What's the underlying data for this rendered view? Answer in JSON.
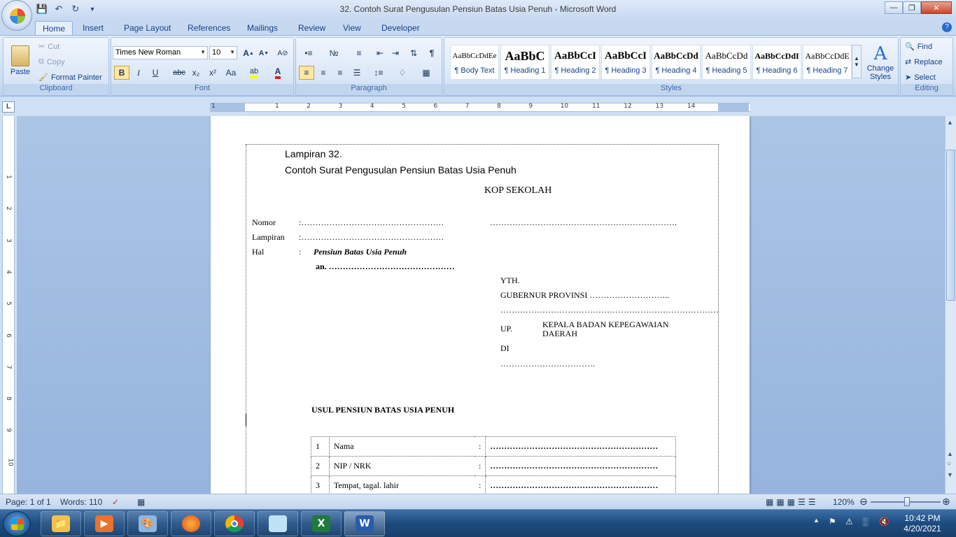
{
  "window": {
    "title": "32. Contoh Surat Pengusulan Pensiun Batas Usia Penuh - Microsoft Word"
  },
  "qat": [
    "save-icon",
    "undo-icon",
    "redo-icon",
    "customize-icon"
  ],
  "tabs": [
    "Home",
    "Insert",
    "Page Layout",
    "References",
    "Mailings",
    "Review",
    "View",
    "Developer"
  ],
  "ribbon": {
    "clipboard": {
      "paste": "Paste",
      "cut": "Cut",
      "copy": "Copy",
      "format_painter": "Format Painter",
      "label": "Clipboard"
    },
    "font": {
      "family": "Times New Roman",
      "size": "10",
      "bold": "B",
      "italic": "I",
      "underline": "U",
      "strike": "abc",
      "subscript": "x₂",
      "superscript": "x²",
      "change_case": "Aa",
      "label": "Font"
    },
    "paragraph": {
      "label": "Paragraph"
    },
    "styles": {
      "cards": [
        {
          "sample": "AaBbCcDdEe",
          "name": "¶ Body Text"
        },
        {
          "sample": "AaBbC",
          "name": "¶ Heading 1"
        },
        {
          "sample": "AaBbCcI",
          "name": "¶ Heading 2"
        },
        {
          "sample": "AaBbCcI",
          "name": "¶ Heading 3"
        },
        {
          "sample": "AaBbCcDd",
          "name": "¶ Heading 4"
        },
        {
          "sample": "AaBbCcDd",
          "name": "¶ Heading 5"
        },
        {
          "sample": "AaBbCcDdI",
          "name": "¶ Heading 6"
        },
        {
          "sample": "AaBbCcDdE",
          "name": "¶ Heading 7"
        }
      ],
      "change_styles": "Change Styles",
      "label": "Styles"
    },
    "editing": {
      "find": "Find",
      "replace": "Replace",
      "select": "Select",
      "label": "Editing"
    }
  },
  "ruler": {
    "corner": "L",
    "marks": [
      "1",
      "1",
      "2",
      "3",
      "4",
      "5",
      "6",
      "7",
      "8",
      "9",
      "10",
      "11",
      "12",
      "13",
      "14"
    ],
    "vmarks": [
      "1",
      "2",
      "3",
      "4",
      "5",
      "6",
      "7",
      "8",
      "9",
      "10"
    ]
  },
  "document": {
    "attachment": "Lampiran 32.",
    "subtitle": "Contoh Surat Pengusulan Pensiun Batas Usia Penuh",
    "kop": "KOP SEKOLAH",
    "nomor_label": "Nomor",
    "nomor_value": ":……………………………………………",
    "date_line": "………………………………………………………….",
    "lampiran_label": "Lampiran",
    "lampiran_value": ":……………………………………………",
    "hal_label": "Hal",
    "hal_colon": ":",
    "hal_value": "Pensiun Batas Usia Penuh",
    "an_line": "an. ………………………………………",
    "yth": "YTH.",
    "gubernur": "GUBERNUR PROVINSI  ………………………..",
    "dotted_line": "……………………………………………………………………",
    "up_label": "UP.",
    "up_value_1": "KEPALA BADAN KEPEGAWAIAN",
    "up_value_2": "DAERAH",
    "di_label": "DI",
    "di_line": "…………………………….",
    "usul": "USUL PENSIUN BATAS USIA PENUH",
    "rows": [
      {
        "no": "1",
        "label": "Nama",
        "colon": ":",
        "value": "……………………………………………………"
      },
      {
        "no": "2",
        "label": "NIP / NRK",
        "colon": ":",
        "value": "……………………………………………………"
      },
      {
        "no": "3",
        "label": "Tempat,  tagal.  lahir",
        "colon": ":",
        "value": "……………………………………………………"
      }
    ]
  },
  "status": {
    "page": "Page: 1 of 1",
    "words": "Words: 110",
    "zoom": "120%"
  },
  "taskbar": {
    "apps": [
      "file-explorer",
      "media-player",
      "paint",
      "firefox",
      "chrome",
      "notepad",
      "excel",
      "word"
    ],
    "time": "10:42 PM",
    "date": "4/20/2021"
  }
}
